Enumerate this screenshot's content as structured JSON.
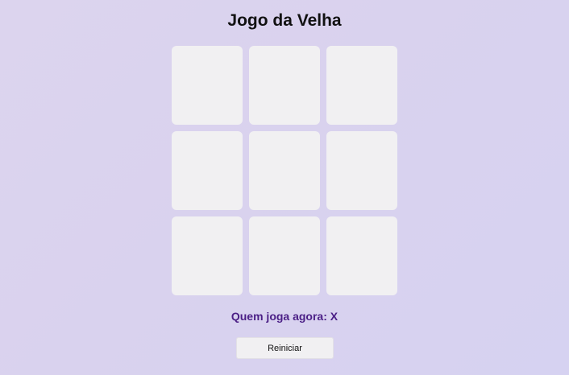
{
  "title": "Jogo da Velha",
  "board": {
    "cells": [
      "",
      "",
      "",
      "",
      "",
      "",
      "",
      "",
      ""
    ]
  },
  "status": {
    "label": "Quem joga agora:",
    "current_player": "X"
  },
  "reset_button": {
    "label": "Reiniciar"
  },
  "colors": {
    "accent": "#4b1f86",
    "cell_background": "#f1f0f2"
  }
}
